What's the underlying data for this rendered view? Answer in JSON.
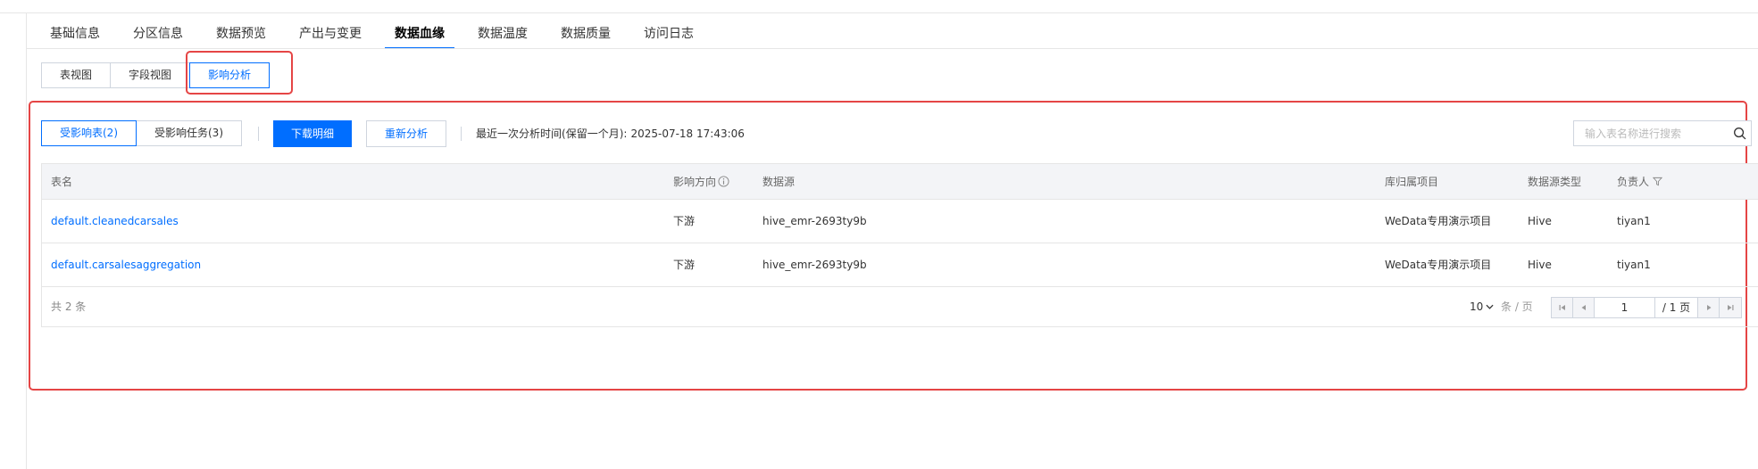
{
  "main_tabs": [
    {
      "label": "基础信息"
    },
    {
      "label": "分区信息"
    },
    {
      "label": "数据预览"
    },
    {
      "label": "产出与变更"
    },
    {
      "label": "数据血缘",
      "active": true
    },
    {
      "label": "数据温度"
    },
    {
      "label": "数据质量"
    },
    {
      "label": "访问日志"
    }
  ],
  "view_tabs": [
    {
      "label": "表视图"
    },
    {
      "label": "字段视图"
    },
    {
      "label": "影响分析",
      "active": true
    }
  ],
  "toolbar": {
    "filter_tabs": [
      {
        "label": "受影响表(2)",
        "active": true
      },
      {
        "label": "受影响任务(3)"
      }
    ],
    "download_label": "下载明细",
    "reanalyze_label": "重新分析",
    "last_analysis_label": "最近一次分析时间(保留一个月):",
    "last_analysis_time": "2025-07-18 17:43:06"
  },
  "search": {
    "placeholder": "输入表名称进行搜索",
    "value": ""
  },
  "table": {
    "columns": [
      "表名",
      "影响方向",
      "数据源",
      "库归属项目",
      "数据源类型",
      "负责人"
    ],
    "rows": [
      {
        "name": "default.cleanedcarsales",
        "direction": "下游",
        "datasource": "hive_emr-2693ty9b",
        "project": "WeData专用演示项目",
        "ds_type": "Hive",
        "owner": "tiyan1"
      },
      {
        "name": "default.carsalesaggregation",
        "direction": "下游",
        "datasource": "hive_emr-2693ty9b",
        "project": "WeData专用演示项目",
        "ds_type": "Hive",
        "owner": "tiyan1"
      }
    ]
  },
  "pagination": {
    "total_label": "共 2 条",
    "page_size": "10",
    "per_page_label": "条 / 页",
    "current_page": "1",
    "total_pages_label": "/ 1 页"
  },
  "colors": {
    "accent": "#006eff",
    "highlight": "#e54545"
  }
}
